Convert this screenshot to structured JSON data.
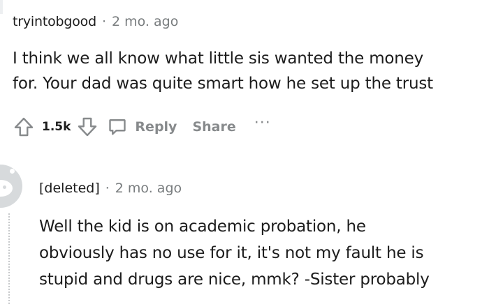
{
  "comment1": {
    "username": "tryintobgood",
    "separator": "·",
    "time": "2 mo. ago",
    "body_line1": "I think we all know what little sis wanted the money",
    "body_line2": "for. Your dad was quite smart how he set up the trust",
    "score": "1.5k",
    "reply_label": "Reply",
    "share_label": "Share",
    "more_label": "···"
  },
  "comment2": {
    "username": "[deleted]",
    "separator": "·",
    "time": "2 mo. ago",
    "body_line1": "Well the kid is on academic probation, he",
    "body_line2": "obviously has no use for it, it's not my fault he is",
    "body_line3": "stupid and drugs are nice, mmk? -Sister probably"
  },
  "icons": {
    "upvote": "upvote-arrow-icon",
    "downvote": "downvote-arrow-icon",
    "reply": "comment-bubble-icon",
    "avatar": "default-snoo-avatar"
  },
  "colors": {
    "text": "#1c1c1c",
    "meta": "#787c7e",
    "action": "#878a8c",
    "avatar_bg": "#d7dadc"
  }
}
